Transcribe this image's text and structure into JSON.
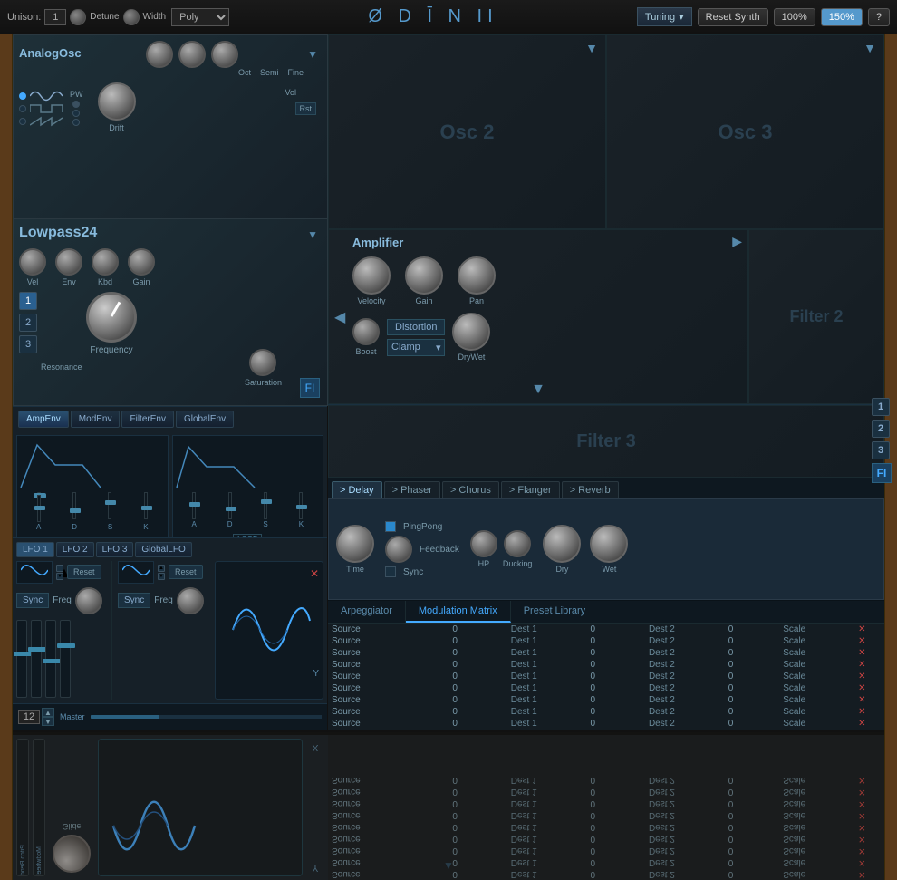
{
  "topbar": {
    "unison_label": "Unison:",
    "unison_value": "1",
    "detune_label": "Detune",
    "width_label": "Width",
    "poly_label": "Poly",
    "logo": "Ø D Ī N II",
    "tuning_label": "Tuning",
    "reset_label": "Reset Synth",
    "zoom1": "100%",
    "zoom2": "150%",
    "help": "?"
  },
  "analog_osc": {
    "title": "AnalogOsc",
    "oct_label": "Oct",
    "semi_label": "Semi",
    "fine_label": "Fine",
    "vol_label": "Vol",
    "rst_label": "Rst",
    "pw_label": "PW",
    "drift_label": "Drift"
  },
  "osc2": {
    "label": "Osc 2"
  },
  "osc3": {
    "label": "Osc 3"
  },
  "filter": {
    "title": "Lowpass24",
    "vel_label": "Vel",
    "env_label": "Env",
    "kbd_label": "Kbd",
    "gain_label": "Gain",
    "freq_label": "Frequency",
    "res_label": "Resonance",
    "sat_label": "Saturation",
    "btn1": "1",
    "btn2": "2",
    "btn3": "3",
    "fi_btn": "FI"
  },
  "filter2": {
    "label": "Filter 2"
  },
  "filter3": {
    "label": "Filter 3"
  },
  "amplifier": {
    "title": "Amplifier",
    "velocity_label": "Velocity",
    "gain_label": "Gain",
    "pan_label": "Pan",
    "distortion_label": "Distortion",
    "clamp_label": "Clamp",
    "boost_label": "Boost",
    "drywet_label": "DryWet"
  },
  "envs": {
    "buttons": [
      "AmpEnv",
      "ModEnv",
      "FilterEnv",
      "GlobalEnv"
    ],
    "adsr_labels": [
      "A",
      "D",
      "S",
      "K"
    ],
    "loop_label": "LOOP"
  },
  "lfos": {
    "buttons": [
      "LFO 1",
      "LFO 2",
      "LFO 3",
      "GlobalLFO"
    ],
    "reset_label": "Reset",
    "sync_label": "Sync",
    "freq_label": "Freq"
  },
  "effects": {
    "tabs": [
      "> Delay",
      "> Phaser",
      "> Chorus",
      "> Flanger",
      "> Reverb"
    ],
    "active_tab": "> Delay",
    "delay": {
      "pingpong_label": "PingPong",
      "feedback_label": "Feedback",
      "time_label": "Time",
      "sync_label": "Sync",
      "hp_label": "HP",
      "ducking_label": "Ducking",
      "dry_label": "Dry",
      "wet_label": "Wet"
    }
  },
  "bottom_panel": {
    "tabs": [
      "Arpeggiator",
      "Modulation Matrix",
      "Preset Library"
    ],
    "active_tab": "Modulation Matrix",
    "mod_headers": [
      "Source",
      "0",
      "Dest 1",
      "0",
      "Dest 2",
      "0",
      "Scale",
      "✕"
    ],
    "mod_rows": [
      [
        "Source",
        "0",
        "Dest 1",
        "0",
        "Dest 2",
        "0",
        "Scale"
      ],
      [
        "Source",
        "0",
        "Dest 1",
        "0",
        "Dest 2",
        "0",
        "Scale"
      ],
      [
        "Source",
        "0",
        "Dest 1",
        "0",
        "Dest 2",
        "0",
        "Scale"
      ],
      [
        "Source",
        "0",
        "Dest 1",
        "0",
        "Dest 2",
        "0",
        "Scale"
      ],
      [
        "Source",
        "0",
        "Dest 1",
        "0",
        "Dest 2",
        "0",
        "Scale"
      ],
      [
        "Source",
        "0",
        "Dest 1",
        "0",
        "Dest 2",
        "0",
        "Scale"
      ],
      [
        "Source",
        "0",
        "Dest 1",
        "0",
        "Dest 2",
        "0",
        "Scale"
      ],
      [
        "Source",
        "0",
        "Dest 1",
        "0",
        "Dest 2",
        "0",
        "Scale"
      ],
      [
        "Source",
        "0",
        "Dest 1",
        "0",
        "Dest 2",
        "0",
        "Scale"
      ]
    ]
  },
  "bottom_controls": {
    "master_label": "Master",
    "num_label": "12",
    "pitch_bend_label": "Pitch Bend",
    "modwheel_label": "Modwheel",
    "glide_label": "Glide",
    "y_label": "Y",
    "x_label": "X",
    "sync_label": "Sync",
    "freq_label": "Freq"
  }
}
